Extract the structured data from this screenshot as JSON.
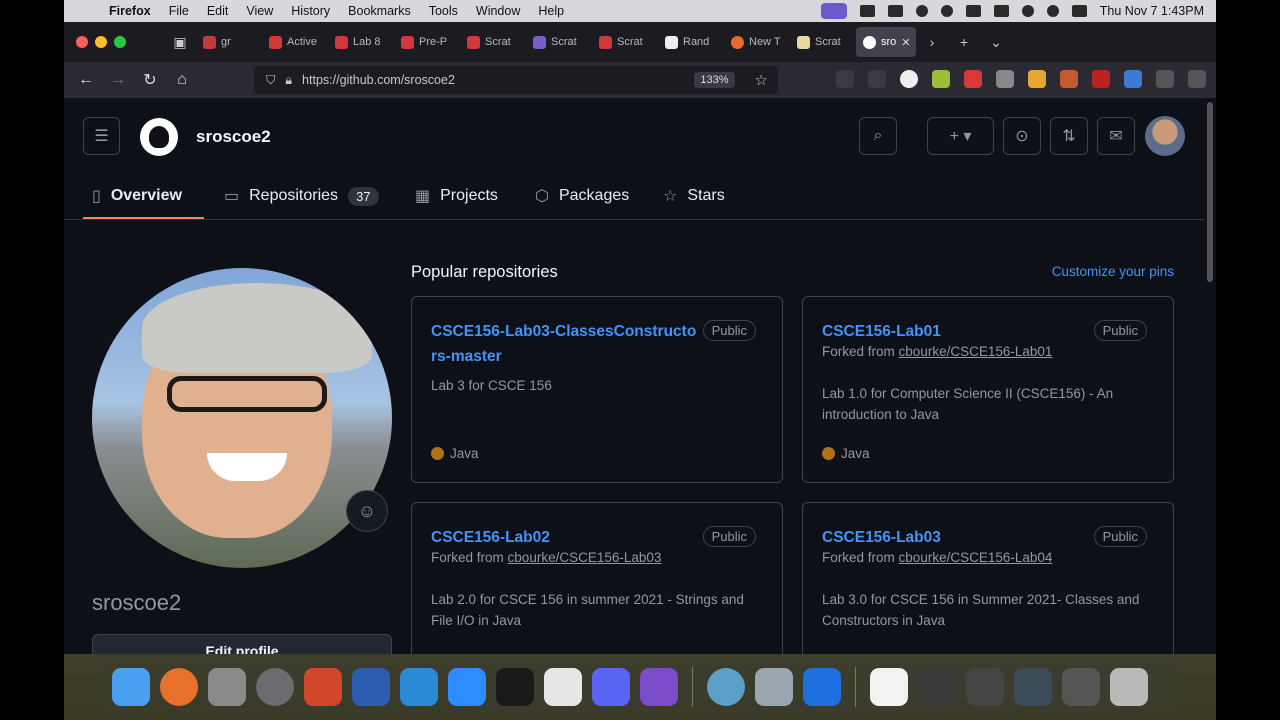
{
  "menubar": {
    "apple_icon": "apple-logo-icon",
    "app_name": "Firefox",
    "menus": [
      "File",
      "Edit",
      "View",
      "History",
      "Bookmarks",
      "Tools",
      "Window",
      "Help"
    ],
    "clock": "Thu Nov 7  1:43PM"
  },
  "tabs": [
    {
      "label": "gr"
    },
    {
      "label": "Active"
    },
    {
      "label": "Lab 8"
    },
    {
      "label": "Pre-P"
    },
    {
      "label": "Scrat"
    },
    {
      "label": "Scrat"
    },
    {
      "label": "Scrat"
    },
    {
      "label": "Rand"
    },
    {
      "label": "New T"
    },
    {
      "label": "Scrat"
    },
    {
      "label": "sro"
    }
  ],
  "browser": {
    "url": "https://github.com/sroscoe2",
    "zoom": "133%"
  },
  "header": {
    "username": "sroscoe2"
  },
  "profile_nav": {
    "overview": "Overview",
    "repositories": "Repositories",
    "repositories_count": "37",
    "projects": "Projects",
    "packages": "Packages",
    "stars": "Stars"
  },
  "sidebar": {
    "login": "sroscoe2",
    "edit_profile": "Edit profile"
  },
  "popular": {
    "title": "Popular repositories",
    "customize": "Customize your pins",
    "repos": [
      {
        "name": "CSCE156-Lab03-ClassesConstructors-master",
        "visibility": "Public",
        "forked_prefix": "",
        "forked_from": "",
        "description": "Lab 3 for CSCE 156",
        "language": "Java"
      },
      {
        "name": "CSCE156-Lab01",
        "visibility": "Public",
        "forked_prefix": "Forked from",
        "forked_from": "cbourke/CSCE156-Lab01",
        "description": "Lab 1.0 for Computer Science II (CSCE156) - An introduction to Java",
        "language": "Java"
      },
      {
        "name": "CSCE156-Lab02",
        "visibility": "Public",
        "forked_prefix": "Forked from",
        "forked_from": "cbourke/CSCE156-Lab03",
        "description": "Lab 2.0 for CSCE 156 in summer 2021 - Strings and File I/O in Java",
        "language": ""
      },
      {
        "name": "CSCE156-Lab03",
        "visibility": "Public",
        "forked_prefix": "Forked from",
        "forked_from": "cbourke/CSCE156-Lab04",
        "description": "Lab 3.0 for CSCE 156 in Summer 2021- Classes and Constructors in Java",
        "language": ""
      }
    ],
    "language_color": "#b07219"
  },
  "theme": {
    "accent_link": "#4493f8",
    "underline": "#f78166",
    "bg": "#0d1117"
  }
}
